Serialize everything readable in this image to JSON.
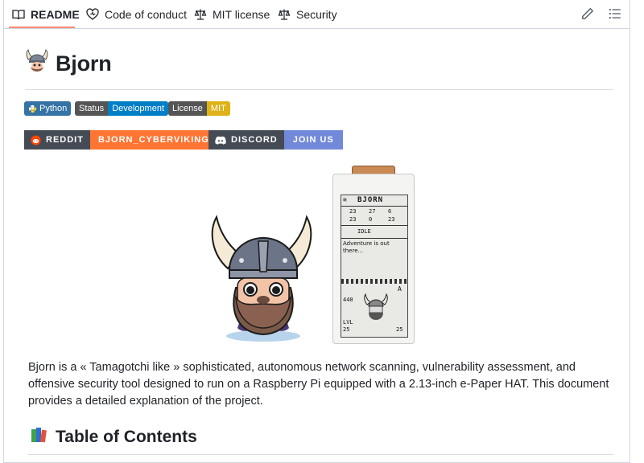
{
  "tabs": [
    {
      "label": "README",
      "icon": "book-icon",
      "active": true
    },
    {
      "label": "Code of conduct",
      "icon": "heart-icon"
    },
    {
      "label": "MIT license",
      "icon": "scale-icon"
    },
    {
      "label": "Security",
      "icon": "scale-icon"
    }
  ],
  "toolbar": {
    "edit_icon": "pencil-icon",
    "outline_icon": "list-icon"
  },
  "readme": {
    "title": "Bjorn",
    "badges": {
      "python": "Python",
      "status_label": "Status",
      "status_value": "Development",
      "license_label": "License",
      "license_value": "MIT"
    },
    "social": {
      "reddit_label": "REDDIT",
      "reddit_value": "BJORN_CYBERVIKING",
      "discord_label": "DISCORD",
      "discord_value": "JOIN US"
    },
    "device": {
      "name": "BJORN",
      "stat1": "23",
      "stat2": "27",
      "stat3": "6",
      "stat4": "23",
      "stat5": "0",
      "stat6": "23",
      "status": "IDLE",
      "message_line1": "Adventure is out",
      "message_line2": "there...",
      "coins": "440",
      "lvl_label": "LVL",
      "lvl": "25",
      "right_top": "A",
      "right_bottom": "25"
    },
    "description": "Bjorn is a « Tamagotchi like » sophisticated, autonomous network scanning, vulnerability assessment, and offensive security tool designed to run on a Raspberry Pi equipped with a 2.13-inch e-Paper HAT. This document provides a detailed explanation of the project.",
    "toc_heading": "Table of Contents"
  },
  "colors": {
    "python_badge": "#3572a5",
    "status_badge": "#007ec6",
    "license_badge": "#dfb317",
    "reddit_badge": "#ff7533",
    "reddit_dark": "#454b54",
    "discord_badge": "#7289da",
    "tab_accent": "#fd8c73"
  }
}
